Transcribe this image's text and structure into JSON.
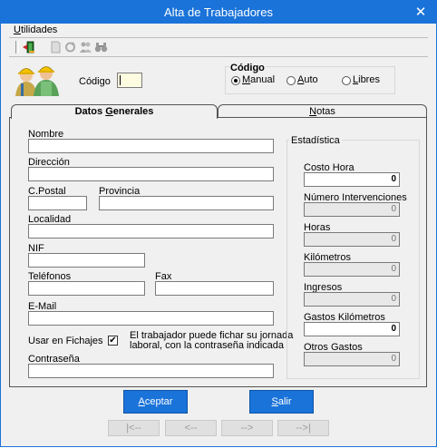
{
  "window": {
    "title": "Alta de Trabajadores",
    "close_glyph": "✕"
  },
  "menu": {
    "utilidades_u": "U",
    "utilidades_rest": "tilidades"
  },
  "toolbar": {
    "icons": [
      "exit-door-icon",
      "document-icon",
      "refresh-icon",
      "users-icon",
      "binoculars-icon"
    ]
  },
  "codigo": {
    "label": "Código",
    "value": "",
    "group_title": "Código",
    "options": [
      {
        "u": "M",
        "rest": "anual",
        "selected": true
      },
      {
        "u": "A",
        "rest": "uto",
        "selected": false
      },
      {
        "u": "L",
        "rest": "ibres",
        "selected": false
      }
    ]
  },
  "tabs": [
    {
      "pre": "Datos ",
      "u": "G",
      "post": "enerales",
      "active": true
    },
    {
      "pre": "",
      "u": "N",
      "post": "otas",
      "active": false
    }
  ],
  "form": {
    "nombre": {
      "label": "Nombre",
      "value": ""
    },
    "direccion": {
      "label": "Dirección",
      "value": ""
    },
    "cpostal": {
      "label": "C.Postal",
      "value": ""
    },
    "provincia": {
      "label": "Provincia",
      "value": ""
    },
    "localidad": {
      "label": "Localidad",
      "value": ""
    },
    "nif": {
      "label": "NIF",
      "value": ""
    },
    "telefonos": {
      "label": "Teléfonos",
      "value": ""
    },
    "fax": {
      "label": "Fax",
      "value": ""
    },
    "email": {
      "label": "E-Mail",
      "value": ""
    },
    "usar_fichajes": {
      "label": "Usar en Fichajes",
      "checked": true,
      "check_glyph": "✔",
      "note_line1": "El trabajador puede fichar su jornada",
      "note_line2": "laboral, con la contraseña indicada"
    },
    "contrasena": {
      "label": "Contraseña",
      "value": ""
    }
  },
  "estadistica": {
    "title": "Estadística",
    "costo_hora": {
      "label": "Costo Hora",
      "value": "0"
    },
    "num_intervenciones": {
      "label": "Número Intervenciones",
      "value": "0"
    },
    "horas": {
      "label": "Horas",
      "value": "0"
    },
    "kilometros": {
      "label": "Kilómetros",
      "value": "0"
    },
    "ingresos": {
      "label": "Ingresos",
      "value": "0"
    },
    "gastos_km": {
      "label": "Gastos Kilómetros",
      "value": "0"
    },
    "otros_gastos": {
      "label": "Otros Gastos",
      "value": "0"
    }
  },
  "buttons": {
    "aceptar": {
      "u": "A",
      "rest": "ceptar"
    },
    "salir": {
      "u": "S",
      "rest": "alir"
    }
  },
  "nav": {
    "first": "|<--",
    "prev": "<--",
    "next": "-->",
    "last": "-->|"
  }
}
